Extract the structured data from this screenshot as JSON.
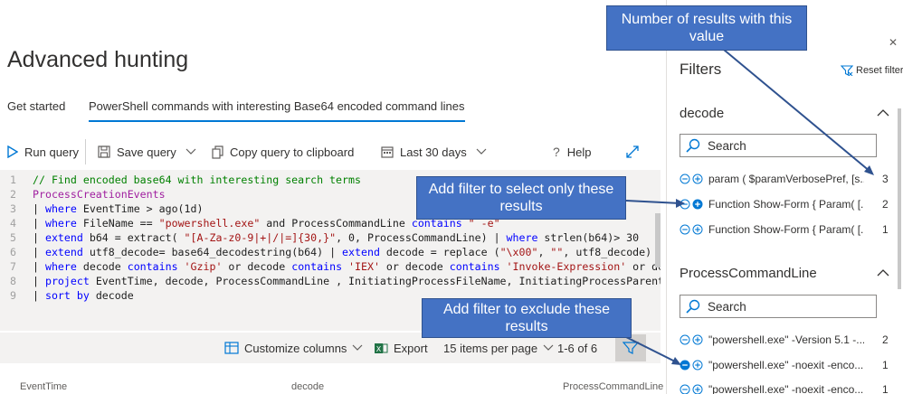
{
  "page": {
    "title": "Advanced hunting"
  },
  "tabs": [
    {
      "label": "Get started"
    },
    {
      "label": "PowerShell commands with interesting Base64 encoded command lines"
    }
  ],
  "toolbar": {
    "run_query": "Run query",
    "save_query": "Save query",
    "copy_query": "Copy query to clipboard",
    "time_range": "Last 30 days",
    "help": "Help"
  },
  "editor": {
    "line_numbers": [
      "1",
      "2",
      "3",
      "4",
      "5",
      "6",
      "7",
      "8",
      "9"
    ],
    "line1": "// Find encoded base64 with interesting search terms",
    "line2": "ProcessCreationEvents",
    "line3": {
      "pipe": "|",
      "kw": "where",
      "rest": " EventTime > ago(1d)"
    },
    "line4": {
      "pipe": "|",
      "kw": "where",
      "a": " FileName == ",
      "str": "\"powershell.exe\"",
      "b": "  and ProcessCommandLine ",
      "kw2": "contains",
      "str2": " \" -e\""
    },
    "line5": {
      "pipe": "|",
      "kw": "extend",
      "a": " b64 = extract( ",
      "str": "\"[A-Za-z0-9|+|/|=]{30,}\"",
      "b": ", 0, ProcessCommandLine) | ",
      "kw2": "where",
      "c": " strlen(b64)> 30"
    },
    "line6": {
      "pipe": "|",
      "kw": "extend",
      "a": " utf8_decode= base64_decodestring(b64) | ",
      "kw2": "extend",
      "b": " decode =  replace (",
      "str": "\"\\x00\"",
      "c": ", ",
      "str2": "\"\"",
      "d": ", utf8_decode)  | ",
      "kw3": "proj"
    },
    "line7": {
      "pipe": "|",
      "kw": "where",
      "a": " decode ",
      "kw2": "contains",
      "str": " 'Gzip'",
      "b": " or decode ",
      "kw3": "contains",
      "str2": " 'IEX'",
      "c": " or decode ",
      "kw4": "contains",
      "str3": " 'Invoke-Expression'",
      "d": " or decode co"
    },
    "line8": {
      "pipe": "|",
      "kw": "project",
      "a": " EventTime, decode, ProcessCommandLine , InitiatingProcessFileName, InitiatingProcessParentFileNa"
    },
    "line9": {
      "pipe": "|",
      "kw": "sort by",
      "a": " decode"
    }
  },
  "results_bar": {
    "customize_columns": "Customize columns",
    "export": "Export",
    "items_per_page": "15 items per page",
    "range": "1-6 of 6"
  },
  "columns": [
    "EventTime",
    "decode",
    "ProcessCommandLine"
  ],
  "filters": {
    "title": "Filters",
    "reset": "Reset filters",
    "sections": [
      {
        "title": "decode",
        "search_placeholder": "Search",
        "items": [
          {
            "label": "param ( $paramVerbosePref, [s...",
            "count": "3"
          },
          {
            "label": "Function Show-Form { Param( [...",
            "count": "2"
          },
          {
            "label": "Function Show-Form { Param( [...",
            "count": "1"
          }
        ]
      },
      {
        "title": "ProcessCommandLine",
        "search_placeholder": "Search",
        "items": [
          {
            "label": "\"powershell.exe\" -Version 5.1 -...",
            "count": "2"
          },
          {
            "label": "\"powershell.exe\" -noexit -enco...",
            "count": "1"
          },
          {
            "label": "\"powershell.exe\" -noexit -enco...",
            "count": "1"
          }
        ]
      }
    ]
  },
  "callouts": {
    "count_note": "Number of results with this value",
    "select_note": "Add filter to select only these results",
    "exclude_note": "Add filter to exclude these results"
  },
  "colors": {
    "accent": "#0078d4",
    "callout": "#4472c4"
  }
}
